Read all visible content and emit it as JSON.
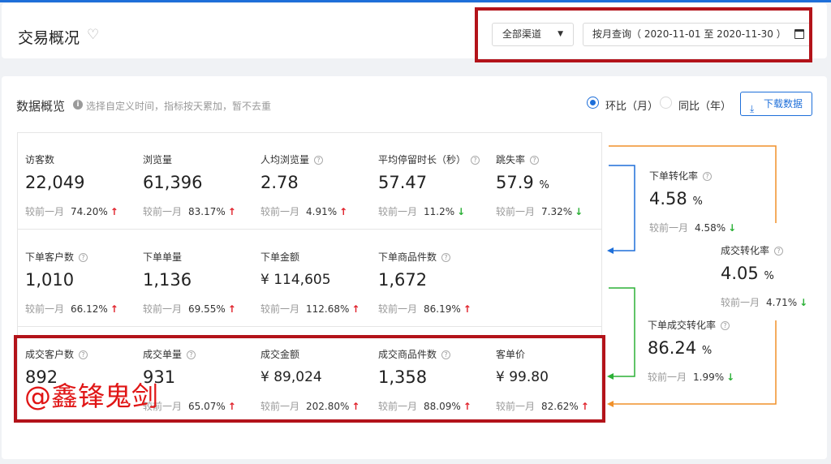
{
  "header": {
    "title": "交易概况",
    "channel_select": "全部渠道",
    "date_range": "按月查询（ 2020-11-01 至 2020-11-30 ）"
  },
  "overview": {
    "title": "数据概览",
    "hint": "选择自定义时间，指标按天累加，暂不去重",
    "compare_mom": "环比（月）",
    "compare_yoy": "同比（年）",
    "download_label": "下载数据",
    "compare_prefix": "较前一月"
  },
  "metrics": [
    {
      "label": "访客数",
      "value": "22,049",
      "pct": "74.20%",
      "trend": "up",
      "help": false
    },
    {
      "label": "浏览量",
      "value": "61,396",
      "pct": "83.17%",
      "trend": "up",
      "help": false
    },
    {
      "label": "人均浏览量",
      "value": "2.78",
      "pct": "4.91%",
      "trend": "up",
      "help": true
    },
    {
      "label": "平均停留时长（秒）",
      "value": "57.47",
      "pct": "11.2%",
      "trend": "down",
      "help": true
    },
    {
      "label": "跳失率",
      "value": "57.9",
      "unit": "%",
      "pct": "7.32%",
      "trend": "down",
      "help": true
    },
    {
      "label": "下单客户数",
      "value": "1,010",
      "pct": "66.12%",
      "trend": "up",
      "help": true
    },
    {
      "label": "下单单量",
      "value": "1,136",
      "pct": "69.55%",
      "trend": "up",
      "help": false
    },
    {
      "label": "下单金额",
      "value": "¥ 114,605",
      "pct": "112.68%",
      "trend": "up",
      "help": false
    },
    {
      "label": "下单商品件数",
      "value": "1,672",
      "pct": "86.19%",
      "trend": "up",
      "help": true
    },
    {
      "label": "成交客户数",
      "value": "892",
      "pct": "",
      "trend": "",
      "help": true
    },
    {
      "label": "成交单量",
      "value": "931",
      "pct": "65.07%",
      "trend": "up",
      "help": true
    },
    {
      "label": "成交金额",
      "value": "¥ 89,024",
      "pct": "202.80%",
      "trend": "up",
      "help": false
    },
    {
      "label": "成交商品件数",
      "value": "1,358",
      "pct": "88.09%",
      "trend": "up",
      "help": true
    },
    {
      "label": "客单价",
      "value": "¥ 99.80",
      "pct": "82.62%",
      "trend": "up",
      "help": false
    }
  ],
  "conversions": [
    {
      "label": "下单转化率",
      "value": "4.58",
      "unit": "%",
      "pct": "4.58%",
      "trend": "down"
    },
    {
      "label": "成交转化率",
      "value": "4.05",
      "unit": "%",
      "pct": "4.71%",
      "trend": "down"
    },
    {
      "label": "下单成交转化率",
      "value": "86.24",
      "unit": "%",
      "pct": "1.99%",
      "trend": "down"
    }
  ],
  "watermark": "@鑫锋鬼剑",
  "icons": {
    "trend_up": "↑",
    "trend_down": "↓",
    "info": "i",
    "help": "?",
    "download": "⤓",
    "heart": "♡",
    "caret": "▼"
  },
  "colors": {
    "accent": "#1e6fd9",
    "up": "#e0212a",
    "down": "#2bb036",
    "flow_orange": "#f0902a",
    "flow_blue": "#1e6fd9",
    "flow_green": "#2bb036",
    "annotation": "#b3131a"
  }
}
